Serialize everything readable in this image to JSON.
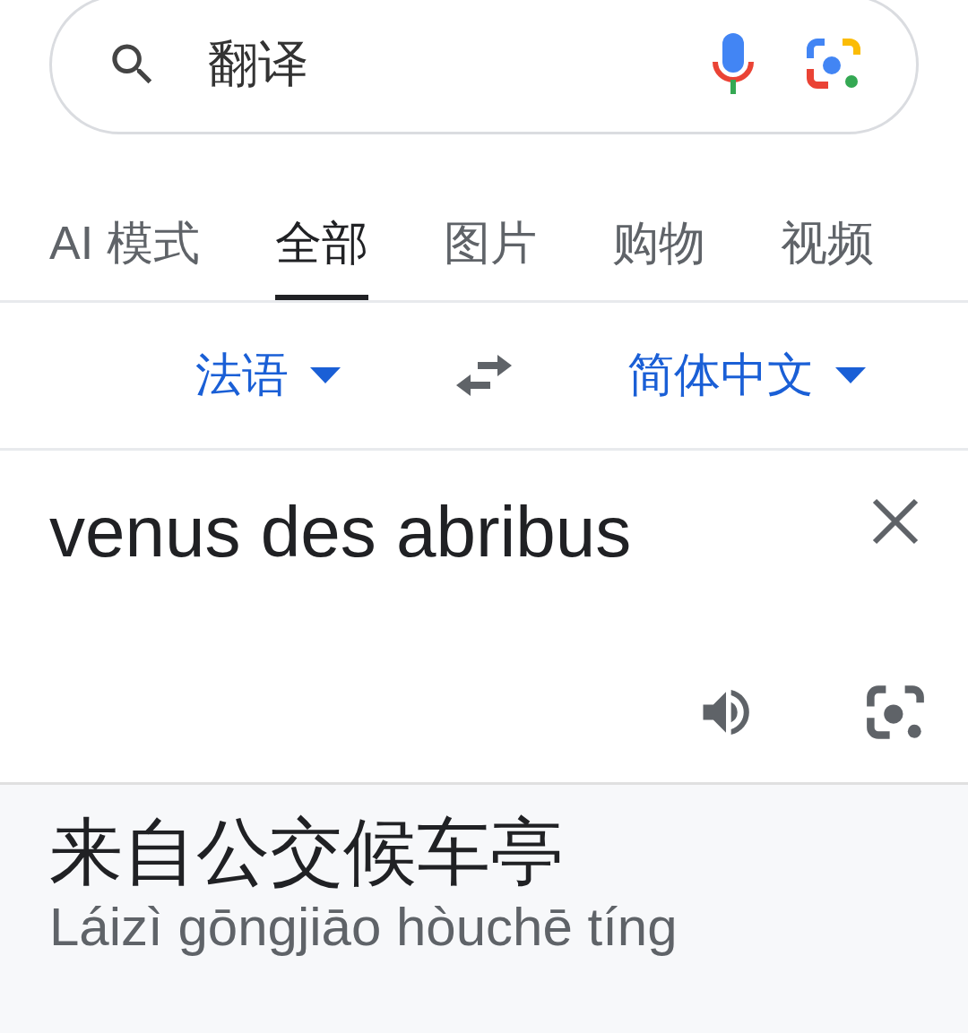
{
  "search": {
    "value": "翻译"
  },
  "tabs": [
    {
      "label": "AI 模式",
      "selected": false
    },
    {
      "label": "全部",
      "selected": true
    },
    {
      "label": "图片",
      "selected": false
    },
    {
      "label": "购物",
      "selected": false
    },
    {
      "label": "视频",
      "selected": false
    }
  ],
  "languages": {
    "source": "法语",
    "target": "简体中文"
  },
  "input": {
    "value": "venus des abribus"
  },
  "result": {
    "text": "来自公交候车亭",
    "pinyin": "Láizì gōngjiāo hòuchē tíng"
  }
}
